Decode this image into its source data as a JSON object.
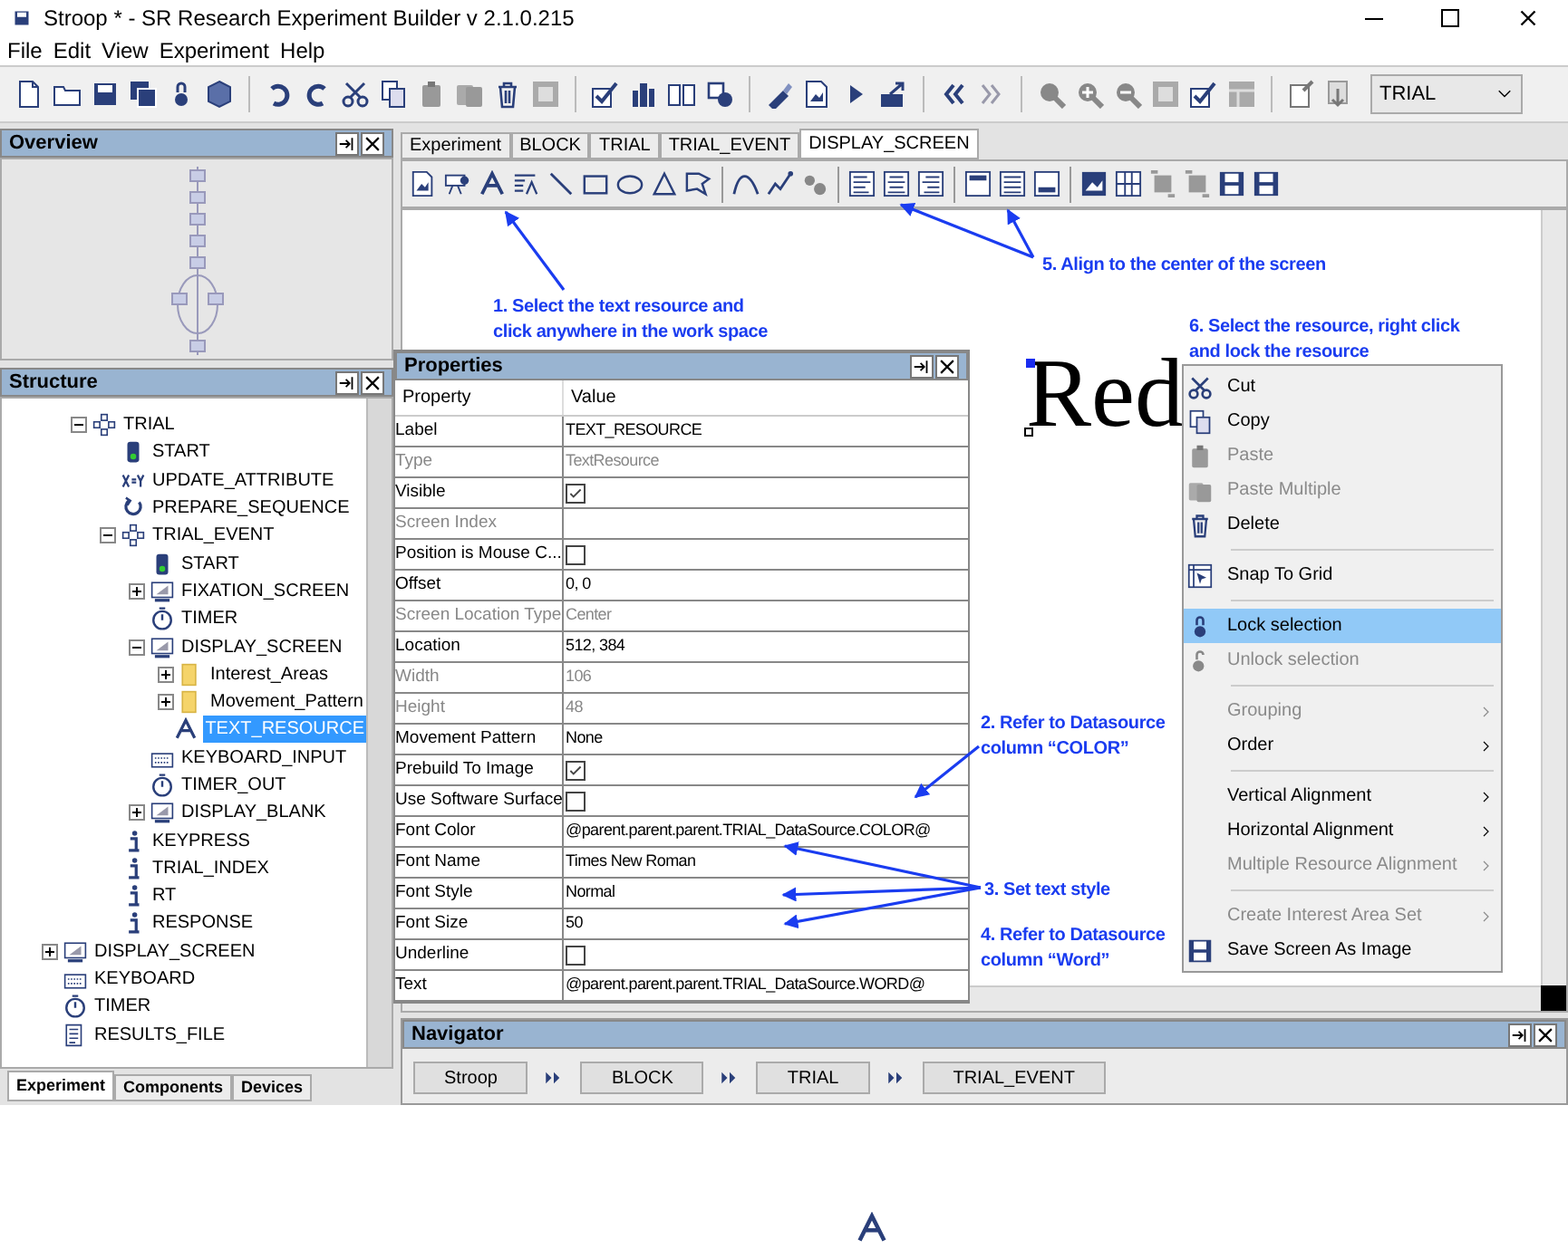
{
  "window": {
    "title": "Stroop * - SR Research Experiment Builder v 2.1.0.215"
  },
  "menu": [
    "File",
    "Edit",
    "View",
    "Experiment",
    "Help"
  ],
  "toolbar": {
    "dropdown": "TRIAL"
  },
  "overview": {
    "title": "Overview"
  },
  "structure": {
    "title": "Structure",
    "scrolled_branch": [
      {
        "label": "TRIAL",
        "kind": "sequence",
        "expanded": true,
        "selected": false,
        "children": [
          {
            "label": "START",
            "kind": "start",
            "selected": false
          },
          {
            "label": "UPDATE_ATTRIBUTE",
            "kind": "update",
            "selected": false
          },
          {
            "label": "PREPARE_SEQUENCE",
            "kind": "prepare",
            "selected": false
          },
          {
            "label": "TRIAL_EVENT",
            "kind": "sequence",
            "expanded": true,
            "selected": false,
            "children": [
              {
                "label": "START",
                "kind": "start",
                "selected": false
              },
              {
                "label": "FIXATION_SCREEN",
                "kind": "display",
                "expanded": false,
                "selected": false
              },
              {
                "label": "TIMER",
                "kind": "timer",
                "selected": false
              },
              {
                "label": "DISPLAY_SCREEN",
                "kind": "display",
                "expanded": true,
                "selected": false,
                "children": [
                  {
                    "label": "Interest_Areas",
                    "kind": "folder",
                    "expanded": false,
                    "selected": false
                  },
                  {
                    "label": "Movement_Pattern",
                    "kind": "folder",
                    "expanded": false,
                    "selected": false
                  },
                  {
                    "label": "TEXT_RESOURCE",
                    "kind": "text",
                    "selected": true
                  }
                ]
              },
              {
                "label": "KEYBOARD_INPUT",
                "kind": "keyboard",
                "selected": false
              },
              {
                "label": "TIMER_OUT",
                "kind": "timer",
                "selected": false
              },
              {
                "label": "DISPLAY_BLANK",
                "kind": "display",
                "expanded": false,
                "selected": false
              }
            ]
          },
          {
            "label": "KEYPRESS",
            "kind": "variable",
            "selected": false
          },
          {
            "label": "TRIAL_INDEX",
            "kind": "variable",
            "selected": false
          },
          {
            "label": "RT",
            "kind": "variable",
            "selected": false
          },
          {
            "label": "RESPONSE",
            "kind": "variable",
            "selected": false
          }
        ]
      }
    ],
    "items": [
      {
        "label": "DISPLAY_SCREEN",
        "kind": "display",
        "expanded": false,
        "selected": false
      },
      {
        "label": "KEYBOARD",
        "kind": "keyboard",
        "selected": false
      },
      {
        "label": "TIMER",
        "kind": "timer",
        "selected": false
      },
      {
        "label": "RESULTS_FILE",
        "kind": "results",
        "selected": false
      }
    ],
    "tabs": [
      {
        "label": "Experiment",
        "selected": true
      },
      {
        "label": "Components",
        "selected": false
      },
      {
        "label": "Devices",
        "selected": false
      }
    ]
  },
  "editor_tabs": [
    {
      "label": "Experiment",
      "selected": false
    },
    {
      "label": "BLOCK",
      "selected": false
    },
    {
      "label": "TRIAL",
      "selected": false
    },
    {
      "label": "TRIAL_EVENT",
      "selected": false
    },
    {
      "label": "DISPLAY_SCREEN",
      "selected": true
    }
  ],
  "canvas": {
    "resource_text": "Red"
  },
  "properties": {
    "title": "Properties",
    "columns": [
      "Property",
      "Value"
    ],
    "rows": [
      {
        "name": "Label",
        "kind": "text",
        "value": "TEXT_RESOURCE",
        "disabled": false
      },
      {
        "name": "Type",
        "kind": "text",
        "value": "TextResource",
        "disabled": true
      },
      {
        "name": "Visible",
        "kind": "checkbox",
        "checked": true,
        "disabled": false
      },
      {
        "name": "Screen Index",
        "kind": "text",
        "disabled": true
      },
      {
        "name": "Position is Mouse C...",
        "kind": "checkbox",
        "checked": false,
        "disabled": false
      },
      {
        "name": "Offset",
        "kind": "text",
        "value": "0, 0",
        "disabled": false
      },
      {
        "name": "Screen Location Type",
        "kind": "text",
        "value": "Center",
        "disabled": true
      },
      {
        "name": "Location",
        "kind": "text",
        "value": "512, 384",
        "disabled": false
      },
      {
        "name": "Width",
        "kind": "text",
        "value": "106",
        "disabled": true
      },
      {
        "name": "Height",
        "kind": "text",
        "value": "48",
        "disabled": true
      },
      {
        "name": "Movement Pattern",
        "kind": "text",
        "value": "None",
        "disabled": false
      },
      {
        "name": "Prebuild To Image",
        "kind": "checkbox",
        "checked": true,
        "disabled": false
      },
      {
        "name": "Use Software Surface",
        "kind": "checkbox",
        "checked": false,
        "disabled": false
      },
      {
        "name": "Font Color",
        "kind": "text",
        "value": "@parent.parent.parent.TRIAL_DataSource.COLOR@",
        "disabled": false
      },
      {
        "name": "Font Name",
        "kind": "text",
        "value": "Times New Roman",
        "disabled": false
      },
      {
        "name": "Font Style",
        "kind": "text",
        "value": "Normal",
        "disabled": false
      },
      {
        "name": "Font Size",
        "kind": "text",
        "value": "50",
        "disabled": false
      },
      {
        "name": "Underline",
        "kind": "checkbox",
        "checked": false,
        "disabled": false
      },
      {
        "name": "Text",
        "kind": "text",
        "value": "@parent.parent.parent.TRIAL_DataSource.WORD@",
        "disabled": false
      }
    ]
  },
  "context_menu": {
    "groups": [
      [
        {
          "label": "Cut",
          "disabled": false,
          "selected": false,
          "submenu": false
        },
        {
          "label": "Copy",
          "disabled": false,
          "selected": false,
          "submenu": false
        },
        {
          "label": "Paste",
          "disabled": true,
          "selected": false,
          "submenu": false
        },
        {
          "label": "Paste Multiple",
          "disabled": true,
          "selected": false,
          "submenu": false
        },
        {
          "label": "Delete",
          "disabled": false,
          "selected": false,
          "submenu": false
        }
      ],
      [
        {
          "label": "Snap To Grid",
          "disabled": false,
          "selected": false,
          "submenu": false
        }
      ],
      [
        {
          "label": "Lock selection",
          "disabled": false,
          "selected": true,
          "submenu": false
        },
        {
          "label": "Unlock selection",
          "disabled": true,
          "selected": false,
          "submenu": false
        }
      ],
      [
        {
          "label": "Grouping",
          "disabled": true,
          "selected": false,
          "submenu": true
        },
        {
          "label": "Order",
          "disabled": false,
          "selected": false,
          "submenu": true
        }
      ],
      [
        {
          "label": "Vertical Alignment",
          "disabled": false,
          "selected": false,
          "submenu": true
        },
        {
          "label": "Horizontal Alignment",
          "disabled": false,
          "selected": false,
          "submenu": true
        },
        {
          "label": "Multiple Resource Alignment",
          "disabled": true,
          "selected": false,
          "submenu": true
        }
      ],
      [
        {
          "label": "Create Interest Area Set",
          "disabled": true,
          "selected": false,
          "submenu": true
        },
        {
          "label": "Save Screen As Image",
          "disabled": false,
          "selected": false,
          "submenu": false
        }
      ]
    ]
  },
  "navigator": {
    "title": "Navigator",
    "crumbs": [
      "Stroop",
      "BLOCK",
      "TRIAL",
      "TRIAL_EVENT"
    ]
  },
  "annotations": [
    {
      "lines": [
        "1. Select the text resource and",
        "click anywhere in the work space"
      ]
    },
    {
      "lines": [
        "5. Align to the center of the screen"
      ]
    },
    {
      "lines": [
        "6. Select the resource, right click",
        "and lock the resource"
      ]
    },
    {
      "lines": [
        "2. Refer to Datasource",
        "column “COLOR”"
      ]
    },
    {
      "lines": [
        "3. Set text style"
      ]
    },
    {
      "lines": [
        "4. Refer to Datasource",
        "column “Word”"
      ]
    }
  ]
}
